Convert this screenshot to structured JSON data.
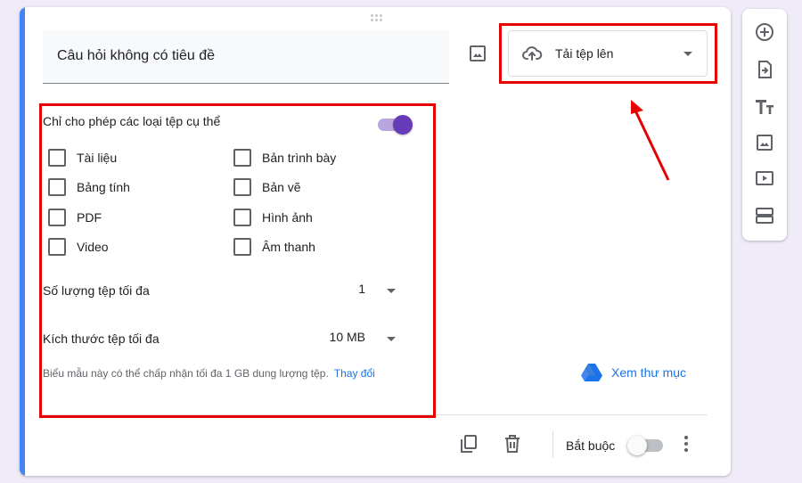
{
  "question": {
    "title": "Câu hỏi không có tiêu đề"
  },
  "type_selector": {
    "label": "Tải tệp lên",
    "icon": "cloud-upload-icon"
  },
  "settings": {
    "allow_specific_label": "Chỉ cho phép các loại tệp cụ thể",
    "allow_specific_on": true,
    "file_types": [
      {
        "label": "Tài liệu",
        "checked": false
      },
      {
        "label": "Bản trình bày",
        "checked": false
      },
      {
        "label": "Bảng tính",
        "checked": false
      },
      {
        "label": "Bản vẽ",
        "checked": false
      },
      {
        "label": "PDF",
        "checked": false
      },
      {
        "label": "Hình ảnh",
        "checked": false
      },
      {
        "label": "Video",
        "checked": false
      },
      {
        "label": "Âm thanh",
        "checked": false
      }
    ],
    "max_files_label": "Số lượng tệp tối đa",
    "max_files_value": "1",
    "max_size_label": "Kích thước tệp tối đa",
    "max_size_value": "10 MB",
    "note": "Biểu mẫu này có thể chấp nhận tối đa 1 GB dung lượng tệp.",
    "change_link": "Thay đổi"
  },
  "drive": {
    "label": "Xem thư mục",
    "icon": "google-drive-icon"
  },
  "footer": {
    "required_label": "Bắt buộc",
    "required_on": false
  },
  "colors": {
    "accent": "#4285f4",
    "toggle": "#673ab7",
    "link": "#1a73e8",
    "annotation": "#e60000"
  },
  "side_toolbar": [
    "add-circle-icon",
    "import-question-icon",
    "title-text-icon",
    "image-icon",
    "video-icon",
    "section-icon"
  ]
}
